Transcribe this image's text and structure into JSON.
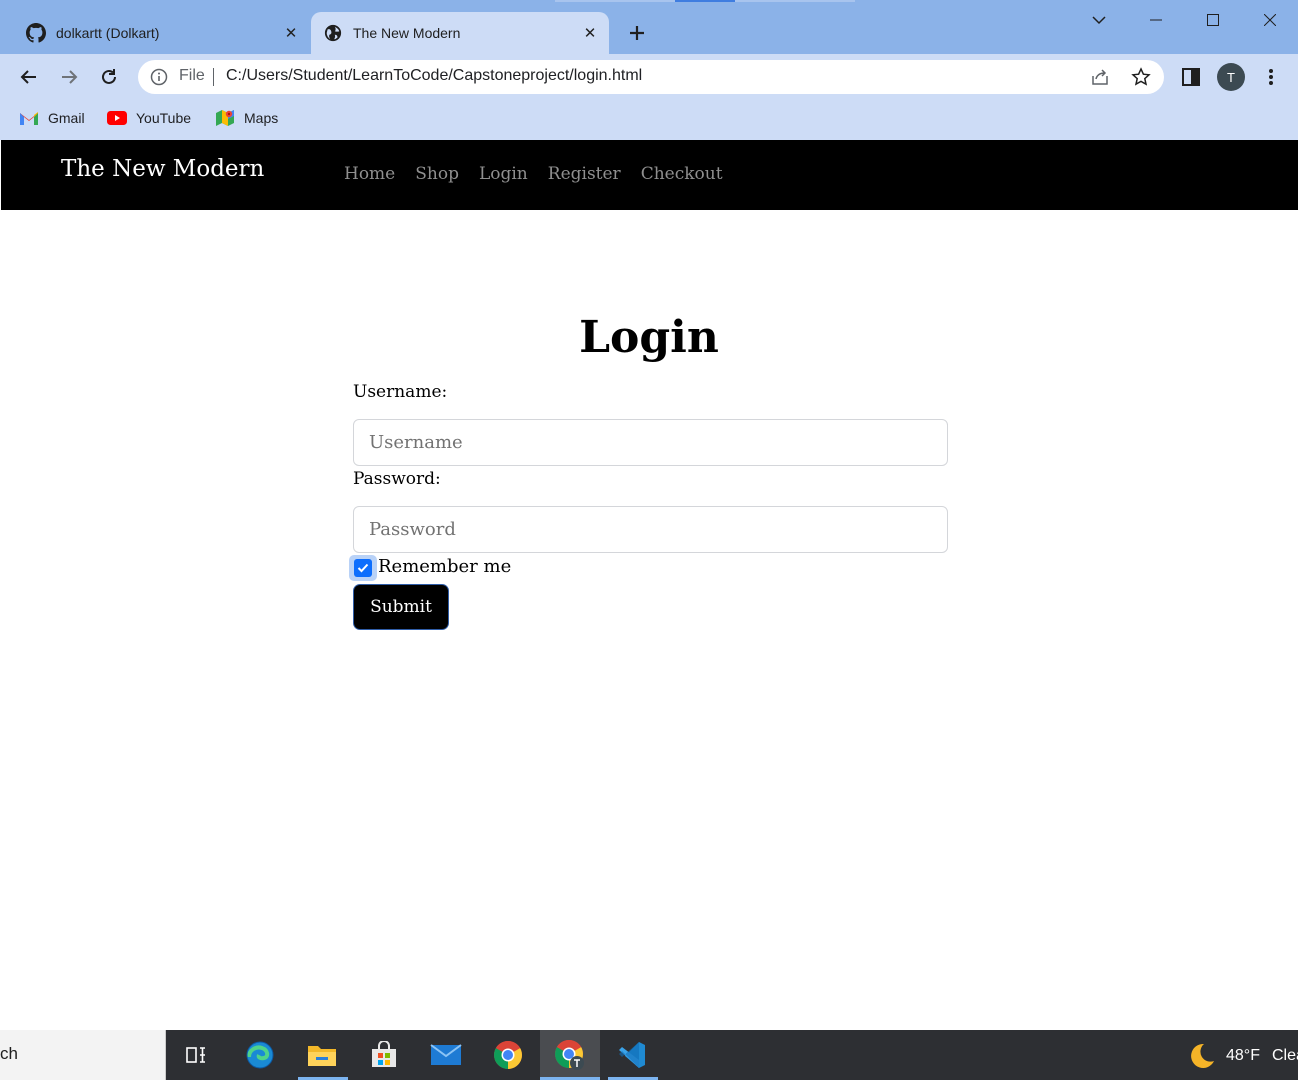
{
  "browser": {
    "tabs": [
      {
        "title": "dolkartt (Dolkart)",
        "favicon": "github-icon",
        "active": false
      },
      {
        "title": "The New Modern",
        "favicon": "globe-icon",
        "active": true
      }
    ],
    "url_scheme_label": "File",
    "url": "C:/Users/Student/LearnToCode/Capstoneproject/login.html",
    "profile_initial": "T",
    "bookmarks": [
      {
        "label": "Gmail",
        "icon": "gmail-icon"
      },
      {
        "label": "YouTube",
        "icon": "youtube-icon"
      },
      {
        "label": "Maps",
        "icon": "maps-icon"
      }
    ]
  },
  "site": {
    "brand": "The New Modern",
    "nav": [
      "Home",
      "Shop",
      "Login",
      "Register",
      "Checkout"
    ]
  },
  "login": {
    "title": "Login",
    "username_label": "Username:",
    "username_placeholder": "Username",
    "password_label": "Password:",
    "password_placeholder": "Password",
    "remember_label": "Remember me",
    "remember_checked": true,
    "submit_label": "Submit"
  },
  "taskbar": {
    "search_text": "ch",
    "apps": [
      "task-view-icon",
      "edge-icon",
      "file-explorer-icon",
      "store-icon",
      "mail-icon",
      "chrome-icon",
      "chrome-profile-icon",
      "vscode-icon"
    ],
    "weather_temp": "48°F",
    "weather_condition": "Clea"
  },
  "colors": {
    "tabbar_bg": "#8bb2e8",
    "toolbar_bg": "#cddcf6",
    "site_nav_bg": "#000000",
    "nav_link": "#8f8f8f",
    "checkbox_accent": "#0d6efd",
    "taskbar_bg": "#2d2f33"
  }
}
